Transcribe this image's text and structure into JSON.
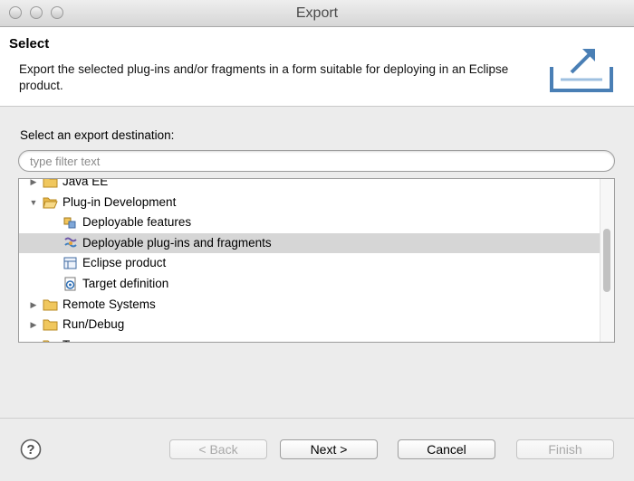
{
  "window": {
    "title": "Export"
  },
  "header": {
    "title": "Select",
    "description": "Export the selected plug-ins and/or fragments in a form suitable for deploying in an Eclipse product."
  },
  "destination": {
    "label": "Select an export destination:",
    "filter_placeholder": "type filter text"
  },
  "tree": {
    "items": [
      {
        "label": "Java EE",
        "expanded": false,
        "icon": "folder-icon"
      },
      {
        "label": "Plug-in Development",
        "expanded": true,
        "icon": "folder-open-icon"
      },
      {
        "label": "Deployable features",
        "icon": "feature-icon"
      },
      {
        "label": "Deployable plug-ins and fragments",
        "icon": "plugin-icon",
        "selected": true
      },
      {
        "label": "Eclipse product",
        "icon": "product-icon"
      },
      {
        "label": "Target definition",
        "icon": "target-icon"
      },
      {
        "label": "Remote Systems",
        "expanded": false,
        "icon": "folder-icon"
      },
      {
        "label": "Run/Debug",
        "expanded": false,
        "icon": "folder-icon"
      },
      {
        "label": "Team",
        "expanded": false,
        "icon": "folder-icon"
      }
    ]
  },
  "buttons": {
    "back": "< Back",
    "next": "Next >",
    "cancel": "Cancel",
    "finish": "Finish"
  },
  "colors": {
    "selection": "#d6d6d6",
    "folder": "#e8b84a"
  }
}
